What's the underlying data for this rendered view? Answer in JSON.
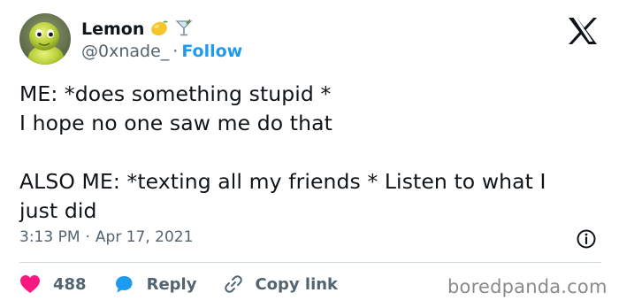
{
  "author": {
    "display_name": "Lemon",
    "name_emojis": [
      "lemon-icon",
      "cocktail-glass-icon"
    ],
    "handle": "@0xnade_",
    "separator": "·",
    "follow_label": "Follow"
  },
  "tweet": {
    "text": "ME: *does something stupid *\nI hope no one saw me do that\n\nALSO ME: *texting all my friends * Listen to what I\njust did",
    "time": "3:13 PM",
    "separator": "·",
    "date": "Apr 17, 2021"
  },
  "actions": {
    "like_count": "488",
    "reply_label": "Reply",
    "copy_link_label": "Copy link"
  },
  "watermark": "boredpanda.com",
  "icons": {
    "logo": "x-logo-icon",
    "info": "info-icon",
    "like": "heart-icon",
    "reply": "reply-bubble-icon",
    "copy": "link-icon"
  },
  "colors": {
    "accent": "#1d9bf0",
    "like": "#f91880",
    "text": "#0f1419",
    "secondary": "#536471",
    "divider": "#cfd9de"
  }
}
